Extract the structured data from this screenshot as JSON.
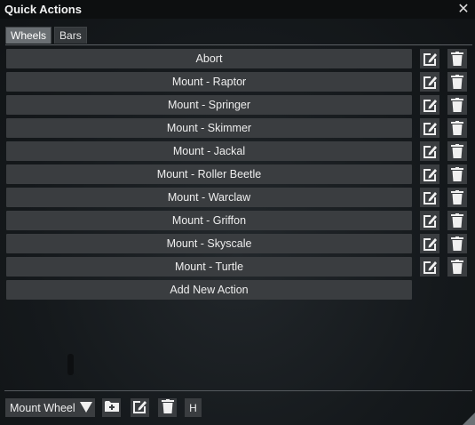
{
  "window": {
    "title": "Quick Actions",
    "close_icon": "close-icon"
  },
  "tabs": [
    {
      "label": "Wheels",
      "active": true
    },
    {
      "label": "Bars",
      "active": false
    }
  ],
  "actions": [
    "Abort",
    "Mount - Raptor",
    "Mount - Springer",
    "Mount - Skimmer",
    "Mount - Jackal",
    "Mount - Roller Beetle",
    "Mount - Warclaw",
    "Mount - Griffon",
    "Mount - Skyscale",
    "Mount - Turtle"
  ],
  "row_icons": {
    "edit": "edit-icon",
    "delete": "trash-icon"
  },
  "add_action_label": "Add New Action",
  "footer": {
    "wheel_select_value": "Mount Wheel",
    "dropdown_icon": "triangle-down-icon",
    "add_icon": "add-folder-icon",
    "edit_icon": "edit-icon",
    "delete_icon": "trash-icon",
    "h_label": "H"
  },
  "colors": {
    "button_bg": "#3a3d40",
    "active_tab": "#6a6f73",
    "titlebar": "#0d0f10"
  }
}
